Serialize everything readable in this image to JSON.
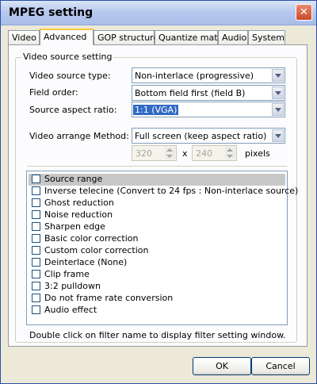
{
  "window": {
    "title": "MPEG setting",
    "close_glyph": "✕"
  },
  "tabs": [
    "Video",
    "Advanced",
    "GOP structure",
    "Quantize matrix",
    "Audio",
    "System"
  ],
  "active_tab": "Advanced",
  "group": {
    "legend": "Video source setting",
    "video_source_type": {
      "label": "Video source type:",
      "value": "Non-interlace (progressive)"
    },
    "field_order": {
      "label": "Field order:",
      "value": "Bottom field first (field B)"
    },
    "source_aspect_ratio": {
      "label": "Source aspect ratio:",
      "value": "1:1 (VGA)"
    },
    "video_arrange_method": {
      "label": "Video arrange Method:",
      "value": "Full screen (keep aspect ratio)"
    },
    "width": "320",
    "times": "x",
    "height": "240",
    "unit": "pixels"
  },
  "filters": [
    {
      "label": "Source range",
      "checked": false,
      "selected": true
    },
    {
      "label": "Inverse telecine (Convert to 24 fps : Non-interlace source)",
      "checked": false
    },
    {
      "label": "Ghost reduction",
      "checked": false
    },
    {
      "label": "Noise reduction",
      "checked": false
    },
    {
      "label": "Sharpen edge",
      "checked": false
    },
    {
      "label": "Basic color correction",
      "checked": false
    },
    {
      "label": "Custom color correction",
      "checked": false
    },
    {
      "label": "Deinterlace (None)",
      "checked": false
    },
    {
      "label": "Clip frame",
      "checked": false
    },
    {
      "label": "3:2 pulldown",
      "checked": false
    },
    {
      "label": "Do not frame rate conversion",
      "checked": false
    },
    {
      "label": "Audio effect",
      "checked": false
    }
  ],
  "hint": "Double click on filter name to display filter setting window.",
  "buttons": {
    "ok": "OK",
    "cancel": "Cancel"
  }
}
